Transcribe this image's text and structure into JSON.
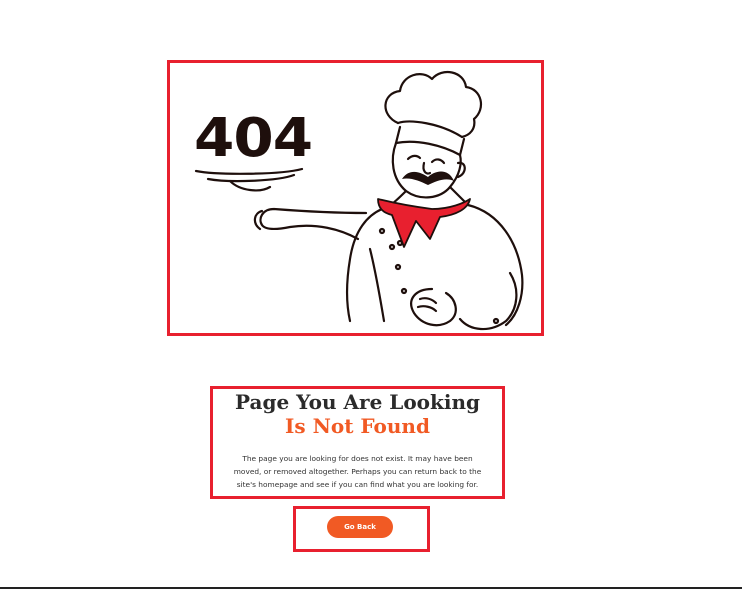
{
  "illustration": {
    "code": "404"
  },
  "heading": {
    "line1": "Page You Are Looking",
    "line2": "Is Not Found"
  },
  "description": "The page you are looking for does not exist. It may have been moved, or removed altogether. Perhaps you can return back to the site's homepage and see if you can find what you are looking for.",
  "button": {
    "label": "Go Back"
  },
  "colors": {
    "accent": "#f15a24",
    "outline": "#e8202f",
    "ink": "#1e0f0c"
  }
}
